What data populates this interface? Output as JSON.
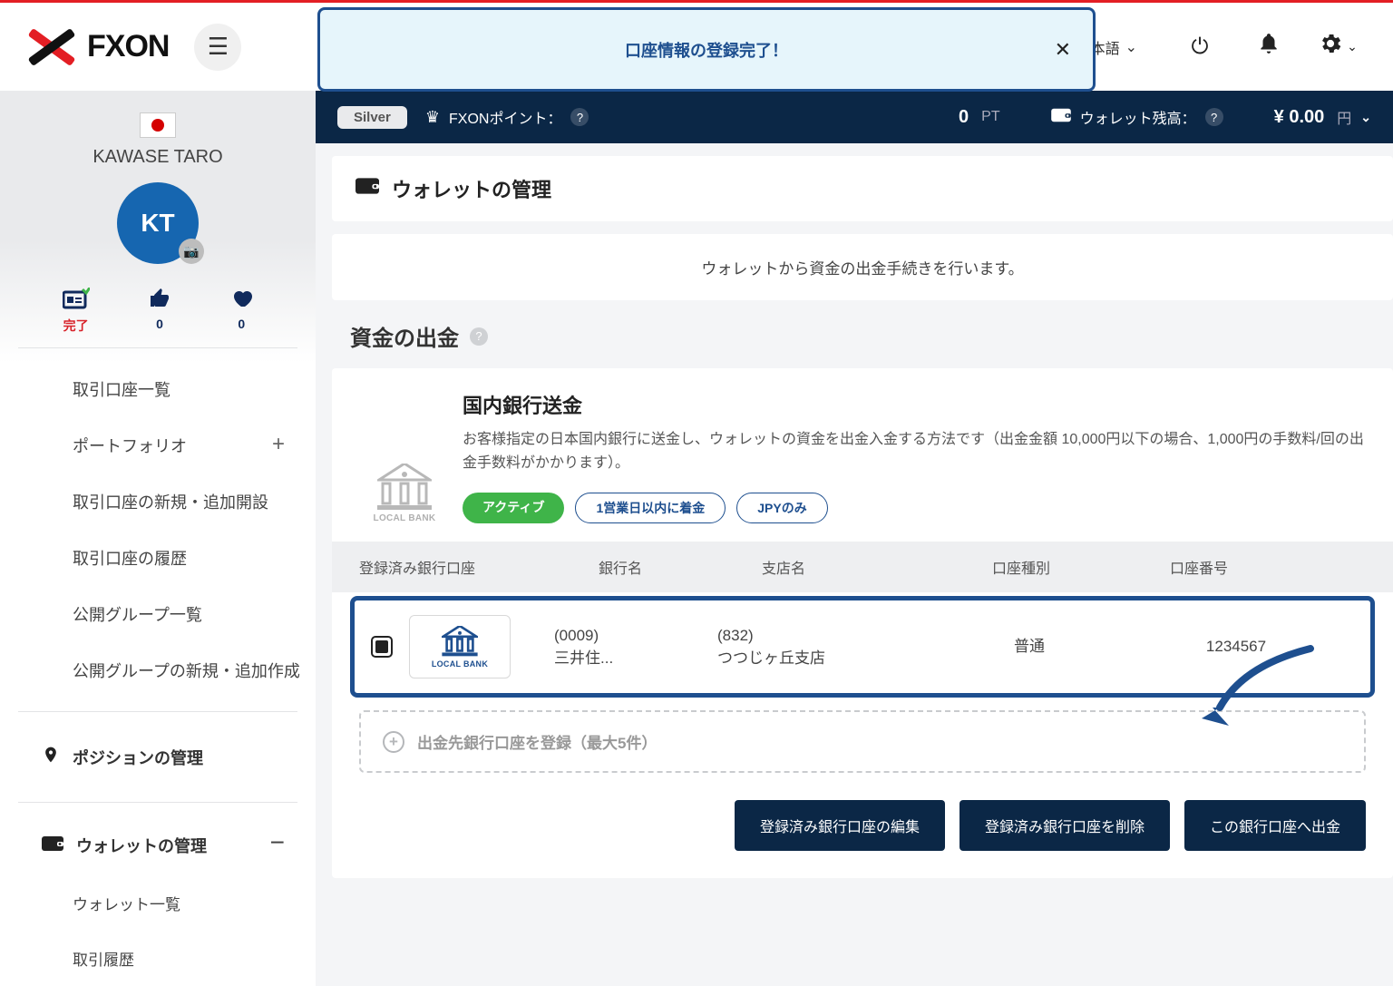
{
  "banner": {
    "text": "口座情報の登録完了！"
  },
  "header": {
    "brand": "FXON",
    "language": "日本語"
  },
  "sidebar": {
    "user_name": "KAWASE TARO",
    "avatar_initials": "KT",
    "stats": {
      "complete_label": "完了",
      "likes": "0",
      "favorites": "0"
    },
    "items": [
      "取引口座一覧",
      "ポートフォリオ",
      "取引口座の新規・追加開設",
      "取引口座の履歴",
      "公開グループ一覧",
      "公開グループの新規・追加作成"
    ],
    "position_section": "ポジションの管理",
    "wallet_section": "ウォレットの管理",
    "wallet_subs": [
      "ウォレット一覧",
      "取引履歴"
    ]
  },
  "infobar": {
    "tier": "Silver",
    "points_label": "FXONポイント：",
    "points_value": "0",
    "points_unit": "PT",
    "wallet_label": "ウォレット残高：",
    "wallet_value": "¥ 0.00",
    "wallet_currency": "円"
  },
  "page": {
    "title": "ウォレットの管理",
    "notice": "ウォレットから資金の出金手続きを行います。",
    "section_title": "資金の出金"
  },
  "card": {
    "title": "国内銀行送金",
    "description": "お客様指定の日本国内銀行に送金し、ウォレットの資金を出金入金する方法です（出金金額 10,000円以下の場合、1,000円の手数料/回の出金手数料がかかります）。",
    "badges": {
      "active": "アクティブ",
      "delivery": "1営業日以内に着金",
      "currency": "JPYのみ"
    },
    "icon_label": "LOCAL BANK"
  },
  "table": {
    "headers": [
      "登録済み銀行口座",
      "銀行名",
      "支店名",
      "口座種別",
      "口座番号"
    ],
    "row": {
      "bank_code": "(0009)",
      "bank_name": "三井住...",
      "branch_code": "(832)",
      "branch_name": "つつじヶ丘支店",
      "type": "普通",
      "number": "1234567",
      "icon_label": "LOCAL BANK"
    },
    "add_label": "出金先銀行口座を登録（最大5件）",
    "buttons": {
      "edit": "登録済み銀行口座の編集",
      "delete": "登録済み銀行口座を削除",
      "withdraw": "この銀行口座へ出金"
    }
  }
}
